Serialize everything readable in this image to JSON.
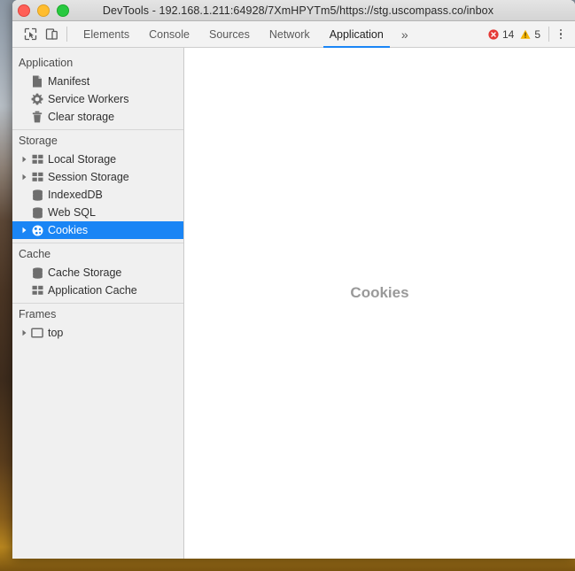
{
  "window": {
    "title": "DevTools - 192.168.1.211:64928/7XmHPYTm5/https://stg.uscompass.co/inbox",
    "controls": {
      "close": "close",
      "minimize": "minimize",
      "maximize": "maximize"
    }
  },
  "toolbar": {
    "inspect_icon": "inspect-cursor-icon",
    "device_icon": "device-toolbar-icon",
    "tabs": [
      {
        "label": "Elements",
        "active": false
      },
      {
        "label": "Console",
        "active": false
      },
      {
        "label": "Sources",
        "active": false
      },
      {
        "label": "Network",
        "active": false
      },
      {
        "label": "Application",
        "active": true
      }
    ],
    "more_tabs_label": "»",
    "errors": {
      "icon": "error-icon",
      "count": "14",
      "color": "#e53935"
    },
    "warnings": {
      "icon": "warning-icon",
      "count": "5",
      "color": "#f5b400"
    },
    "menu_icon": "kebab-menu-icon",
    "active_tab_underline_color": "#1a85f5"
  },
  "sidebar": {
    "selection_color": "#1a85f5",
    "sections": [
      {
        "title": "Application",
        "items": [
          {
            "label": "Manifest",
            "icon": "document-icon",
            "twisty": false,
            "selected": false
          },
          {
            "label": "Service Workers",
            "icon": "gear-icon",
            "twisty": false,
            "selected": false
          },
          {
            "label": "Clear storage",
            "icon": "trash-icon",
            "twisty": false,
            "selected": false
          }
        ]
      },
      {
        "title": "Storage",
        "items": [
          {
            "label": "Local Storage",
            "icon": "table-icon",
            "twisty": true,
            "selected": false
          },
          {
            "label": "Session Storage",
            "icon": "table-icon",
            "twisty": true,
            "selected": false
          },
          {
            "label": "IndexedDB",
            "icon": "database-icon",
            "twisty": false,
            "selected": false
          },
          {
            "label": "Web SQL",
            "icon": "database-icon",
            "twisty": false,
            "selected": false
          },
          {
            "label": "Cookies",
            "icon": "cookie-icon",
            "twisty": true,
            "selected": true
          }
        ]
      },
      {
        "title": "Cache",
        "items": [
          {
            "label": "Cache Storage",
            "icon": "database-icon",
            "twisty": false,
            "selected": false
          },
          {
            "label": "Application Cache",
            "icon": "table-icon",
            "twisty": false,
            "selected": false
          }
        ]
      },
      {
        "title": "Frames",
        "items": [
          {
            "label": "top",
            "icon": "frame-icon",
            "twisty": true,
            "selected": false
          }
        ]
      }
    ]
  },
  "main": {
    "placeholder": "Cookies"
  }
}
